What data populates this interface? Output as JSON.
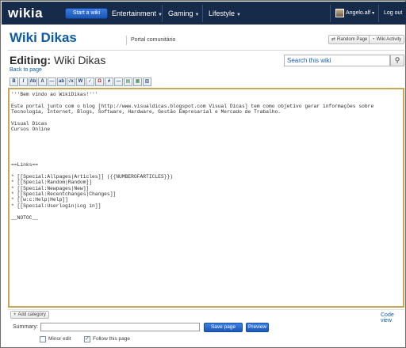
{
  "nav": {
    "logo": "wikia",
    "start_wiki": "Start a wiki",
    "hubs": [
      "Entertainment",
      "Gaming",
      "Lifestyle"
    ],
    "caret": "▼",
    "username": "Angelo.alf",
    "logout": "Log out"
  },
  "header": {
    "wiki_title": "Wiki Dikas",
    "portal_link": "Portal comunitário",
    "random_page": "Random Page",
    "wiki_activity": "Wiki Activity"
  },
  "editing": {
    "label": "Editing:",
    "page_name": "Wiki Dikas",
    "back_link": "Back to page",
    "search_placeholder": "Search this wiki"
  },
  "toolbar": {
    "buttons": [
      "B",
      "I",
      "Ab",
      "A",
      "—",
      "ab",
      "√x",
      "W",
      "✓",
      "Ω",
      "#",
      "—",
      "▤",
      "▦",
      "▧"
    ]
  },
  "editor": {
    "content": "'''Bem vindo ao WikiDikas!'''\n\nEste portal junto com o blog [http://www.visualdicas.blogspot.com Visual Dicas] tem como objetivo gerar informações sobre\nTecnologia, Internet, Blogs, Software, Hardware, Gestão Empresarial e Mercado de Trabalho.\n\nVisual Dicas\nCursos Online\n\n\n\n\n\n==Links==\n\n* [[Special:Allpages|Articles]] ({{NUMBEROFARTICLES}})\n* [[Special:Random|Random]]\n* [[Special:Newpages|New]]\n* [[Special:Recentchanges|Changes]]\n* [[w:c:Help|Help]]\n* [[Special:Userlogin|Log in]]\n\n__NOTOC__"
  },
  "footer": {
    "add_category": "Add category",
    "code_view": "Code view",
    "summary_label": "Summary:",
    "summary_value": "",
    "save_page": "Save page",
    "preview": "Preview",
    "minor_edit": "Minor edit",
    "minor_edit_checked": false,
    "follow_page": "Follow this page",
    "follow_page_checked": true
  },
  "colors": {
    "nav_bg": "#162a49",
    "link_blue": "#0e5ca3",
    "button_blue": "#1b58b8",
    "editor_border": "#c7a65a"
  }
}
